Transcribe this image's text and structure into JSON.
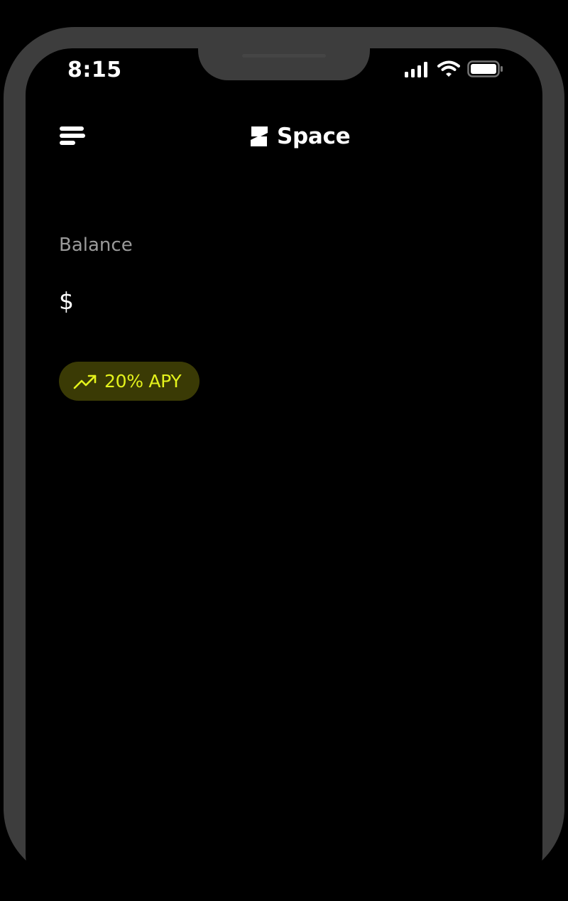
{
  "status_bar": {
    "time": "8:15",
    "icons": [
      "signal-icon",
      "wifi-icon",
      "battery-icon"
    ]
  },
  "header": {
    "menu_icon": "menu-icon",
    "brand_name": "Space",
    "brand_logo": "space-logo-icon"
  },
  "balance": {
    "label": "Balance",
    "value": "$"
  },
  "apy_badge": {
    "icon": "trending-up-icon",
    "label": "20% APY"
  },
  "colors": {
    "background": "#000000",
    "frame": "#3d3d3d",
    "text_primary": "#ffffff",
    "text_secondary": "#9a9a9a",
    "accent": "#e4f21c",
    "badge_background": "#3a3a05"
  }
}
